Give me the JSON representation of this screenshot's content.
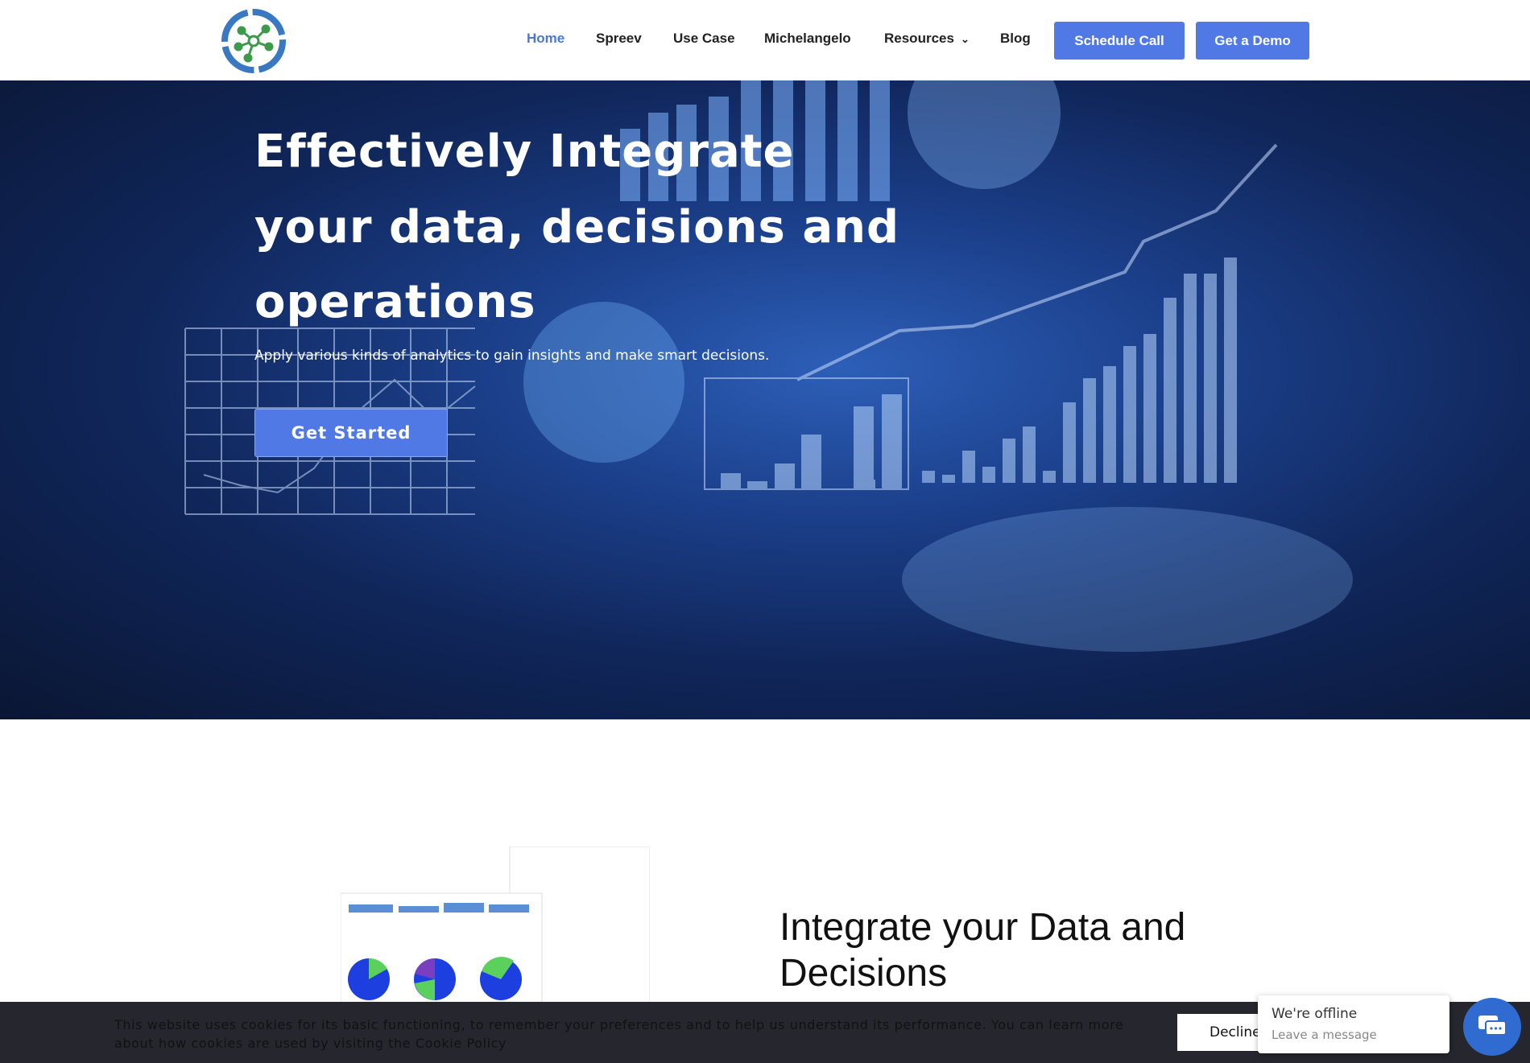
{
  "header": {
    "nav": [
      {
        "label": "Home",
        "active": true
      },
      {
        "label": "Spreev"
      },
      {
        "label": "Use Case"
      },
      {
        "label": "Michelangelo"
      },
      {
        "label": "Resources"
      },
      {
        "label": "Blog"
      }
    ],
    "schedule_call": "Schedule Call",
    "get_demo": "Get a Demo"
  },
  "hero": {
    "title_lines": [
      "Effectively Integrate",
      "your data, decisions and",
      "operations"
    ],
    "subtitle": "Apply various kinds of analytics to gain insights and make smart decisions.",
    "cta": "Get Started"
  },
  "section2": {
    "title": "Integrate your Data and Decisions"
  },
  "cookie": {
    "text": "This website uses cookies for its basic functioning, to remember your preferences and to help us understand its performance. You can learn more about how cookies are used by visiting the Cookie Policy",
    "decline": "Decline"
  },
  "chat": {
    "status": "We're offline",
    "prompt": "Leave a message"
  },
  "colors": {
    "accent": "#5079e6",
    "hero_bg": "#1b3f8a",
    "cookie_bg": "#26262e",
    "chat": "#2f6bd0"
  }
}
